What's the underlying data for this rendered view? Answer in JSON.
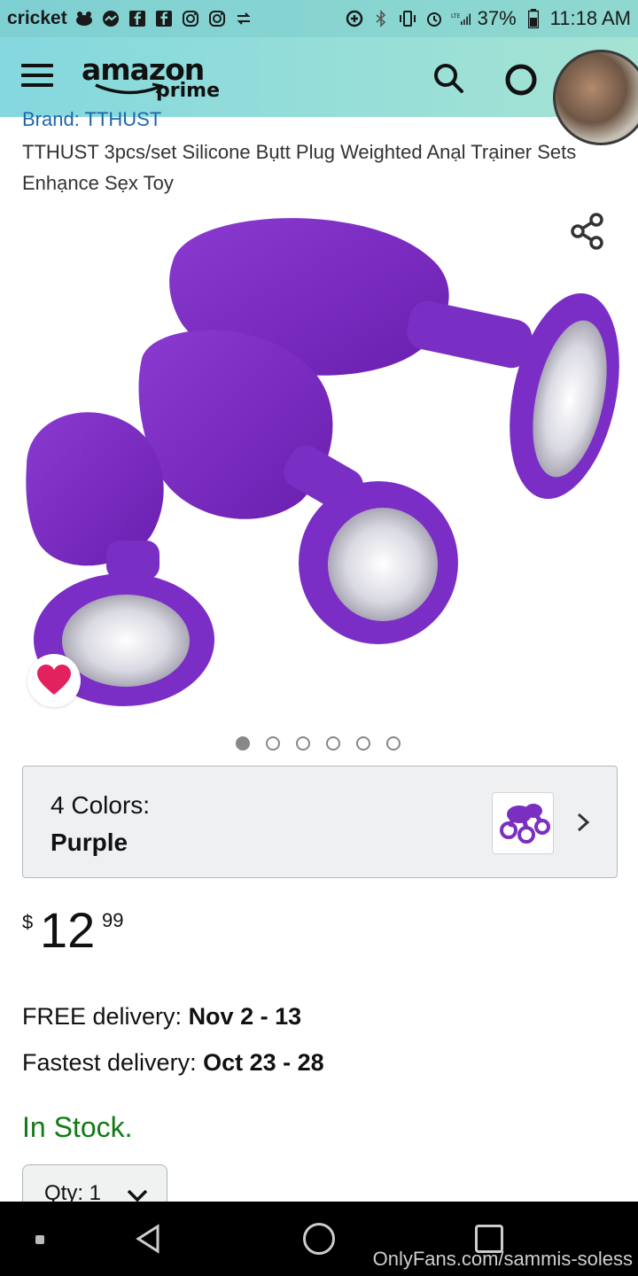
{
  "status_bar": {
    "carrier": "cricket",
    "battery": "37%",
    "time": "11:18 AM"
  },
  "header": {
    "logo_main": "amazon",
    "logo_sub": "prime",
    "accent_color": "#84d8de"
  },
  "product": {
    "brand": "Brand: TTHUST",
    "title": "TTHUST 3pcs/set Silicone Bụtt Plug Weighted Anạl Trạiner Sets Enhạnce Sẹx Toy",
    "image_icon": "product-image",
    "image_count": 6,
    "active_image_index": 0
  },
  "color_selector": {
    "label": "4 Colors:",
    "value": "Purple",
    "swatch_color": "#7a2fc0"
  },
  "price": {
    "currency": "$",
    "whole": "12",
    "fraction": "99"
  },
  "delivery": {
    "free_label": "FREE delivery: ",
    "free_dates": "Nov 2 - 13",
    "fast_label": "Fastest delivery: ",
    "fast_dates": "Oct 23 - 28"
  },
  "stock": {
    "text": "In Stock.",
    "color": "#117a11"
  },
  "quantity": {
    "label": "Qty: 1"
  },
  "watermark": "OnlyFans.com/sammis-soless"
}
